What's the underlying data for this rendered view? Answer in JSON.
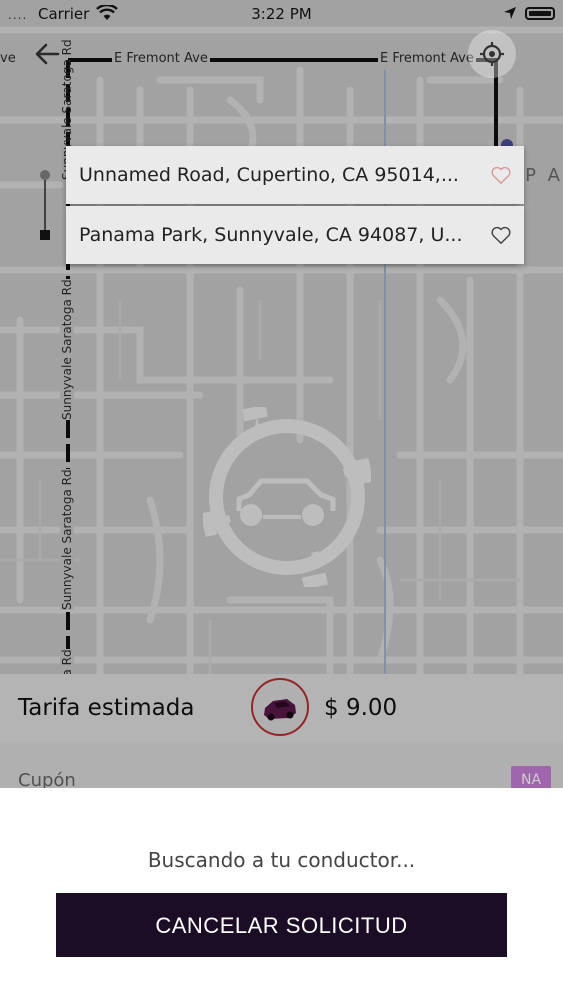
{
  "status_bar": {
    "signal_dots": "....",
    "carrier": "Carrier",
    "time": "3:22 PM"
  },
  "map": {
    "street_top_left": "ve",
    "street_top_1": "E Fremont Ave",
    "street_top_2": "E Fremont Ave",
    "street_left_upper": "Sunnyvale Saratoga Rd",
    "street_left_mid": "Sunnyvale Saratoga Rd",
    "street_left_lower": "Sunnyvale Saratoga Rd",
    "street_left_bottom": "Sunnyvale Saratoga Rd",
    "area_label": "P A"
  },
  "route": {
    "origin": "Unnamed Road, Cupertino, CA 95014,...",
    "destination": "Panama Park, Sunnyvale, CA 94087, U..."
  },
  "fare": {
    "label": "Tarifa estimada",
    "price": "$ 9.00",
    "car_color": "#5a1a4a"
  },
  "coupon": {
    "label": "Cupón",
    "badge": "NA"
  },
  "sheet": {
    "message": "Buscando a tu conductor...",
    "cancel_label": "CANCELAR SOLICITUD",
    "button_color": "#1b0d26"
  }
}
